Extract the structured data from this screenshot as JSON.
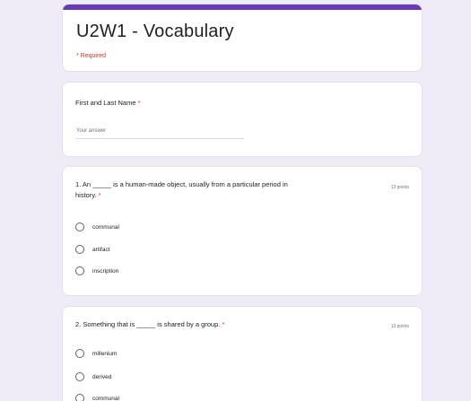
{
  "header": {
    "title": "U2W1 - Vocabulary",
    "required_note": "* Required"
  },
  "name_question": {
    "label": "First and Last Name",
    "required_mark": "*",
    "placeholder": "Your answer"
  },
  "questions": [
    {
      "text_line1": "1. An _____ is a human-made object, usually from a particular period in",
      "text_line2": "history.",
      "required_mark": "*",
      "points": "13 points",
      "options": [
        "communal",
        "artifact",
        "inscription"
      ]
    },
    {
      "text_line1": "2. Something that is _____ is shared by a group.",
      "required_mark": "*",
      "points": "13 points",
      "options": [
        "millenium",
        "derived",
        "communal"
      ]
    }
  ],
  "colors": {
    "accent": "#673ab7",
    "required": "#d93025",
    "background": "#efebf7"
  }
}
